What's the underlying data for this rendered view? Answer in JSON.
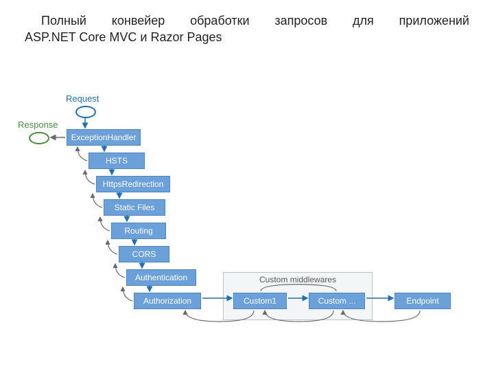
{
  "title_line1": "Полный конвейер обработки запросов для приложений",
  "title_line2": "ASP.NET Core MVC и Razor Pages",
  "labels": {
    "request": "Request",
    "response": "Response",
    "custom_group": "Custom middlewares"
  },
  "pipeline": {
    "m1": "ExceptionHandler",
    "m2": "HSTS",
    "m3": "HttpsRedirection",
    "m4": "Static Files",
    "m5": "Routing",
    "m6": "CORS",
    "m7": "Authentication",
    "m8": "Authorization",
    "c1": "Custom1",
    "c2": "Custom ...",
    "ep": "Endpoint"
  },
  "colors": {
    "box_fill": "#6ba0d8",
    "box_border": "#4b85be",
    "request": "#1f6fb8",
    "response": "#4a8f3f",
    "arrow_fwd": "#1f6fb8",
    "arrow_back": "#6b6b6b",
    "group_bg": "#f3f5f7",
    "group_border": "#b8c2cb"
  }
}
